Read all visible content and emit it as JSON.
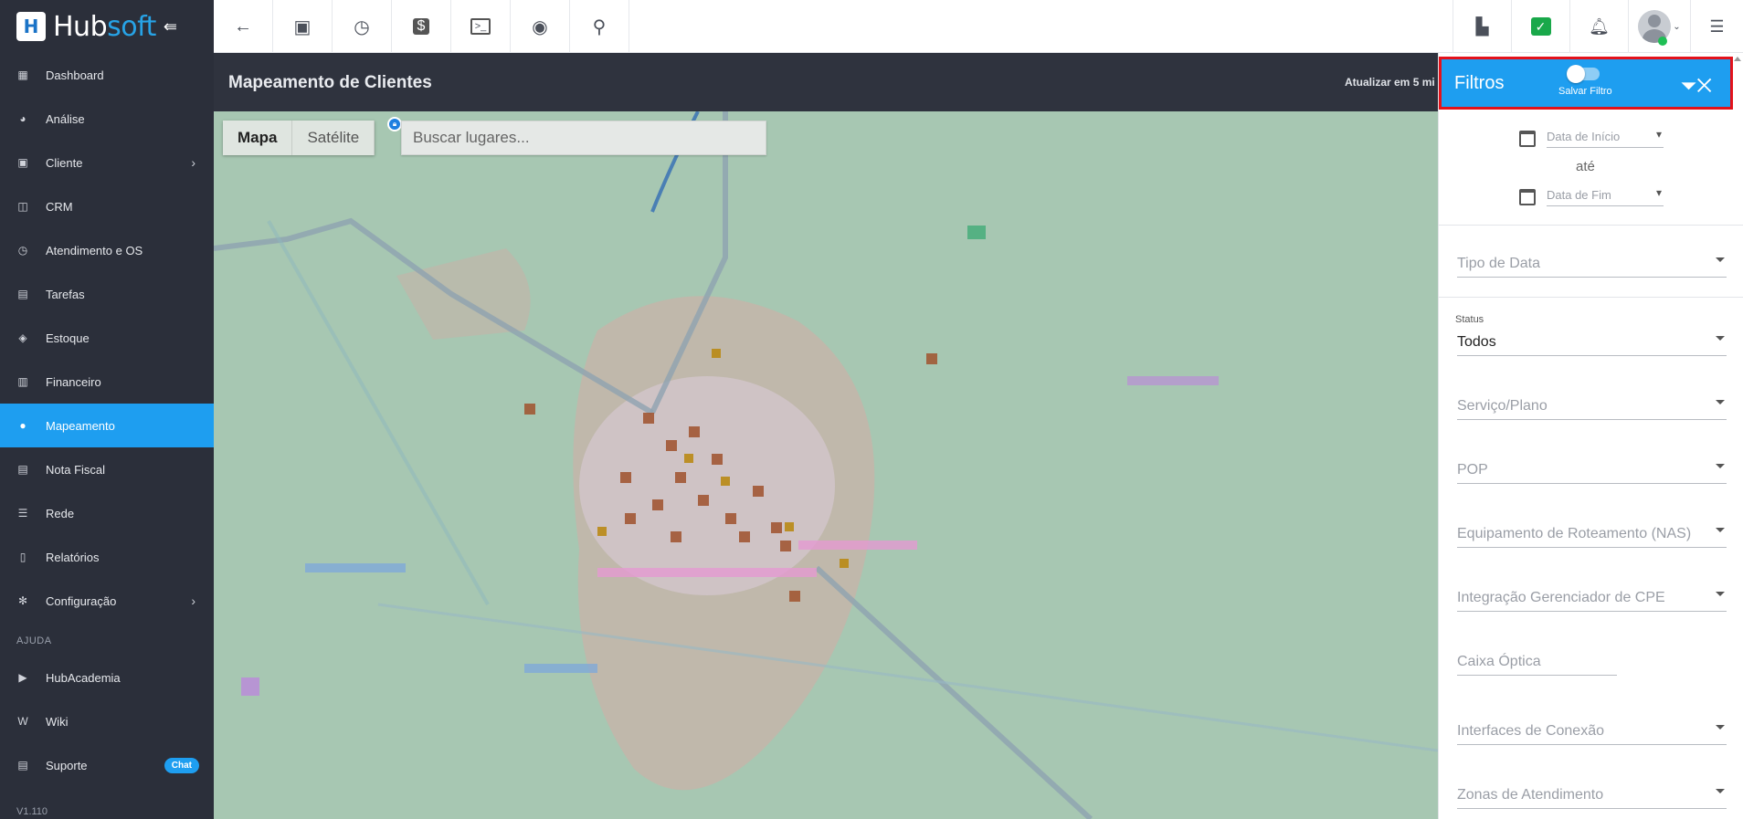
{
  "brand": {
    "logo_letter": "H",
    "name_part1": "Hub",
    "name_part2": "soft"
  },
  "sidebar": {
    "items": [
      {
        "label": "Dashboard",
        "icon": "dashboard-icon"
      },
      {
        "label": "Análise",
        "icon": "pie-chart-icon"
      },
      {
        "label": "Cliente",
        "icon": "contact-card-icon"
      },
      {
        "label": "CRM",
        "icon": "crm-icon"
      },
      {
        "label": "Atendimento e OS",
        "icon": "calendar-clock-icon"
      },
      {
        "label": "Tarefas",
        "icon": "tasks-icon"
      },
      {
        "label": "Estoque",
        "icon": "box-icon"
      },
      {
        "label": "Financeiro",
        "icon": "money-icon"
      },
      {
        "label": "Mapeamento",
        "icon": "map-pin-icon"
      },
      {
        "label": "Nota Fiscal",
        "icon": "receipt-icon"
      },
      {
        "label": "Rede",
        "icon": "network-icon"
      },
      {
        "label": "Relatórios",
        "icon": "report-icon"
      },
      {
        "label": "Configuração",
        "icon": "gear-icon"
      }
    ],
    "help_section": "AJUDA",
    "help_items": [
      {
        "label": "HubAcademia",
        "icon": "video-icon"
      },
      {
        "label": "Wiki",
        "icon": "wiki-icon"
      },
      {
        "label": "Suporte",
        "icon": "chat-icon",
        "badge": "Chat"
      }
    ],
    "version": "V1.110"
  },
  "header": {
    "title": "Mapeamento de Clientes",
    "update_text": "Atualizar em 5 mi"
  },
  "map": {
    "tabs": [
      "Mapa",
      "Satélite"
    ],
    "search_placeholder": "Buscar lugares..."
  },
  "filters": {
    "title": "Filtros",
    "save_label": "Salvar Filtro",
    "date_start": "Data de Início",
    "date_sep": "até",
    "date_end": "Data de Fim",
    "tipo_data": "Tipo de Data",
    "status_label": "Status",
    "status_value": "Todos",
    "servico": "Serviço/Plano",
    "pop": "POP",
    "equipamento": "Equipamento de Roteamento (NAS)",
    "integracao": "Integração Gerenciador de CPE",
    "caixa": "Caixa Óptica",
    "interfaces": "Interfaces de Conexão",
    "zonas": "Zonas de Atendimento"
  },
  "colors": {
    "accent": "#1e9ef0",
    "sidebar_bg": "#2b2f3a",
    "highlight_border": "#e3121b"
  }
}
